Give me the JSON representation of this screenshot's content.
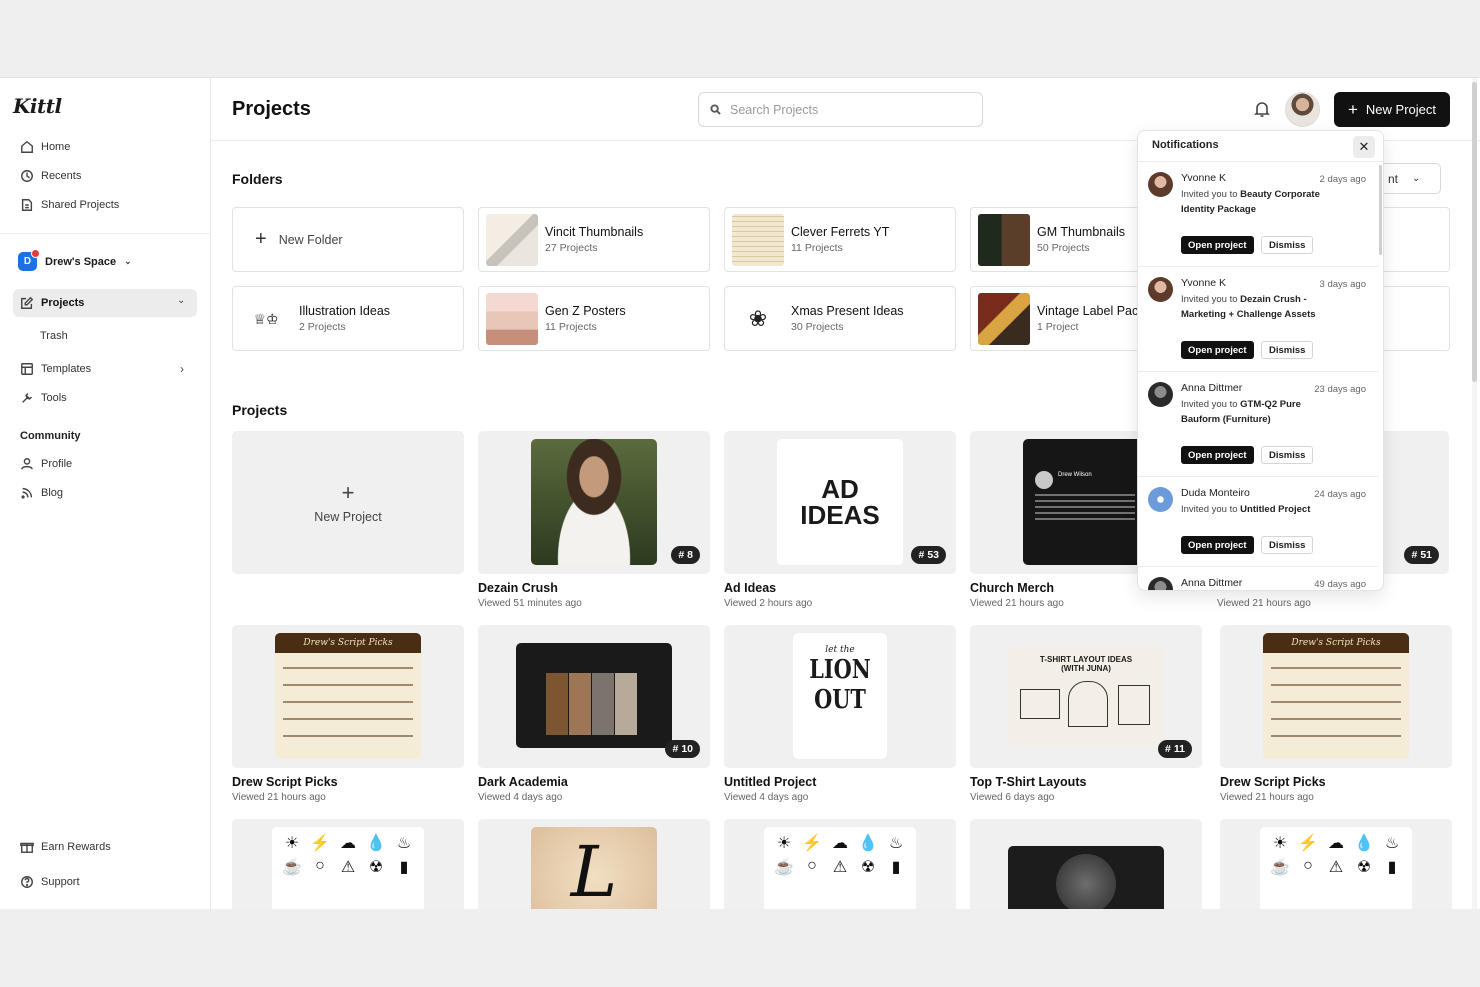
{
  "app": {
    "logo": "Kittl"
  },
  "sidebar": {
    "nav": [
      {
        "label": "Home",
        "icon": "home-icon"
      },
      {
        "label": "Recents",
        "icon": "clock-icon"
      },
      {
        "label": "Shared Projects",
        "icon": "shared-icon"
      }
    ],
    "space": {
      "badge": "D",
      "label": "Drew's Space"
    },
    "projects_label": "Projects",
    "trash_label": "Trash",
    "templates_label": "Templates",
    "tools_label": "Tools",
    "community_title": "Community",
    "profile_label": "Profile",
    "blog_label": "Blog",
    "earn_rewards_label": "Earn Rewards",
    "support_label": "Support"
  },
  "header": {
    "title": "Projects",
    "search_placeholder": "Search Projects",
    "new_project_label": "New Project"
  },
  "sort": {
    "value": "nt"
  },
  "folders": {
    "title": "Folders",
    "new_folder_label": "New Folder",
    "items": [
      {
        "name": "Vincit Thumbnails",
        "count": "27 Projects"
      },
      {
        "name": "Clever Ferrets YT",
        "count": "11 Projects"
      },
      {
        "name": "GM Thumbnails",
        "count": "50 Projects"
      },
      {
        "name": "Illustration Ideas",
        "count": "2 Projects"
      },
      {
        "name": "Gen Z Posters",
        "count": "11 Projects"
      },
      {
        "name": "Xmas Present Ideas",
        "count": "30 Projects"
      },
      {
        "name": "Vintage Label Pac",
        "count": "1 Project"
      }
    ]
  },
  "projects": {
    "title": "Projects",
    "new_project_label": "New Project",
    "items": [
      {
        "name": "Dezain Crush",
        "viewed": "Viewed 51 minutes ago",
        "badge": "8"
      },
      {
        "name": "Ad Ideas",
        "viewed": "Viewed 2 hours ago",
        "badge": "53",
        "art_text": "AD IDEAS"
      },
      {
        "name": "Church Merch",
        "viewed": "Viewed 21 hours ago",
        "art_author": "Drew Wilson"
      },
      {
        "name": "",
        "viewed": "Viewed 21 hours ago",
        "badge": "51"
      },
      {
        "name": "Drew Script Picks",
        "viewed": "Viewed 21 hours ago",
        "art_title": "Drew's Script Picks"
      },
      {
        "name": "Dark Academia",
        "viewed": "Viewed 4 days ago",
        "badge": "10"
      },
      {
        "name": "Untitled Project",
        "viewed": "Viewed 4 days ago",
        "art_text": "LION OUT",
        "art_small": "let the"
      },
      {
        "name": "Top T-Shirt Layouts",
        "viewed": "Viewed 6 days ago",
        "badge": "11",
        "art_title": "T-SHIRT LAYOUT IDEAS (WITH JUNA)"
      },
      {
        "name": "Drew Script Picks",
        "viewed": "Viewed 21 hours ago",
        "art_title": "Drew's Script Picks"
      }
    ]
  },
  "notifications": {
    "title": "Notifications",
    "items": [
      {
        "name": "Yvonne K",
        "time": "2 days ago",
        "prefix": "Invited you to ",
        "target": "Beauty Corporate Identity Package"
      },
      {
        "name": "Yvonne K",
        "time": "3 days ago",
        "prefix": "Invited you to ",
        "target": "Dezain Crush - Marketing + Challenge Assets"
      },
      {
        "name": "Anna Dittmer",
        "time": "23 days ago",
        "prefix": "Invited you to ",
        "target": "GTM-Q2 Pure Bauform (Furniture)"
      },
      {
        "name": "Duda Monteiro",
        "time": "24 days ago",
        "prefix": "Invited you to ",
        "target": "Untitled Project"
      },
      {
        "name": "Anna Dittmer",
        "time": "49 days ago"
      }
    ],
    "open_label": "Open project",
    "dismiss_label": "Dismiss"
  },
  "colors": {
    "accent": "#111111",
    "brand_badge": "#1f6fe5",
    "notification_dot": "#e53935"
  }
}
